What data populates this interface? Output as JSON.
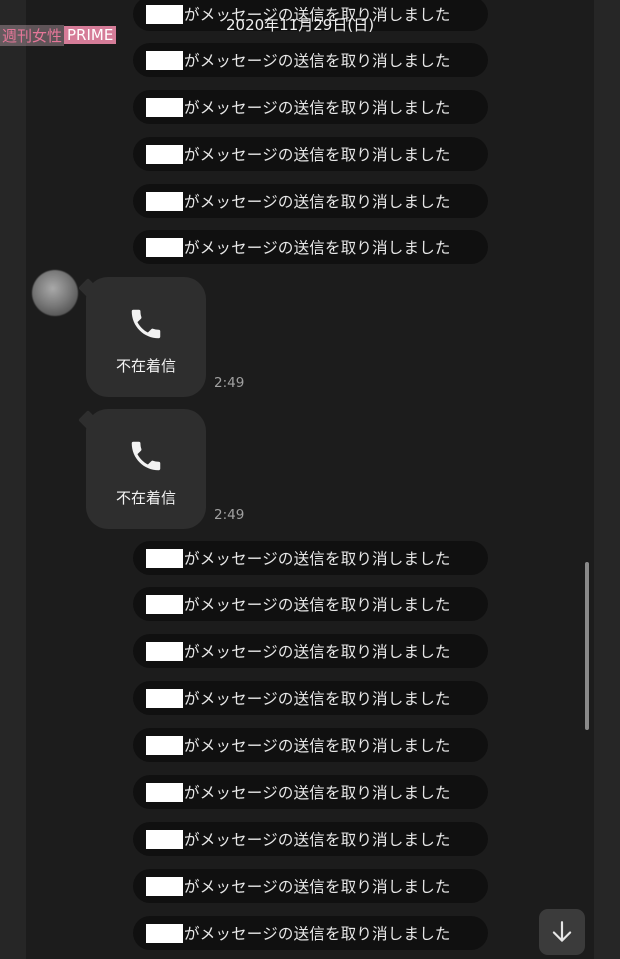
{
  "watermark": {
    "jp": "週刊女性",
    "en": "PRIME"
  },
  "date_header": "2020年11月29日(日)",
  "system_message": "がメッセージの送信を取り消しました",
  "calls": [
    {
      "label": "不在着信",
      "time": "2:49"
    },
    {
      "label": "不在着信",
      "time": "2:49"
    }
  ],
  "icons": {
    "phone": "phone-icon",
    "scroll": "arrow-down-icon",
    "redaction": "redacted-name"
  }
}
